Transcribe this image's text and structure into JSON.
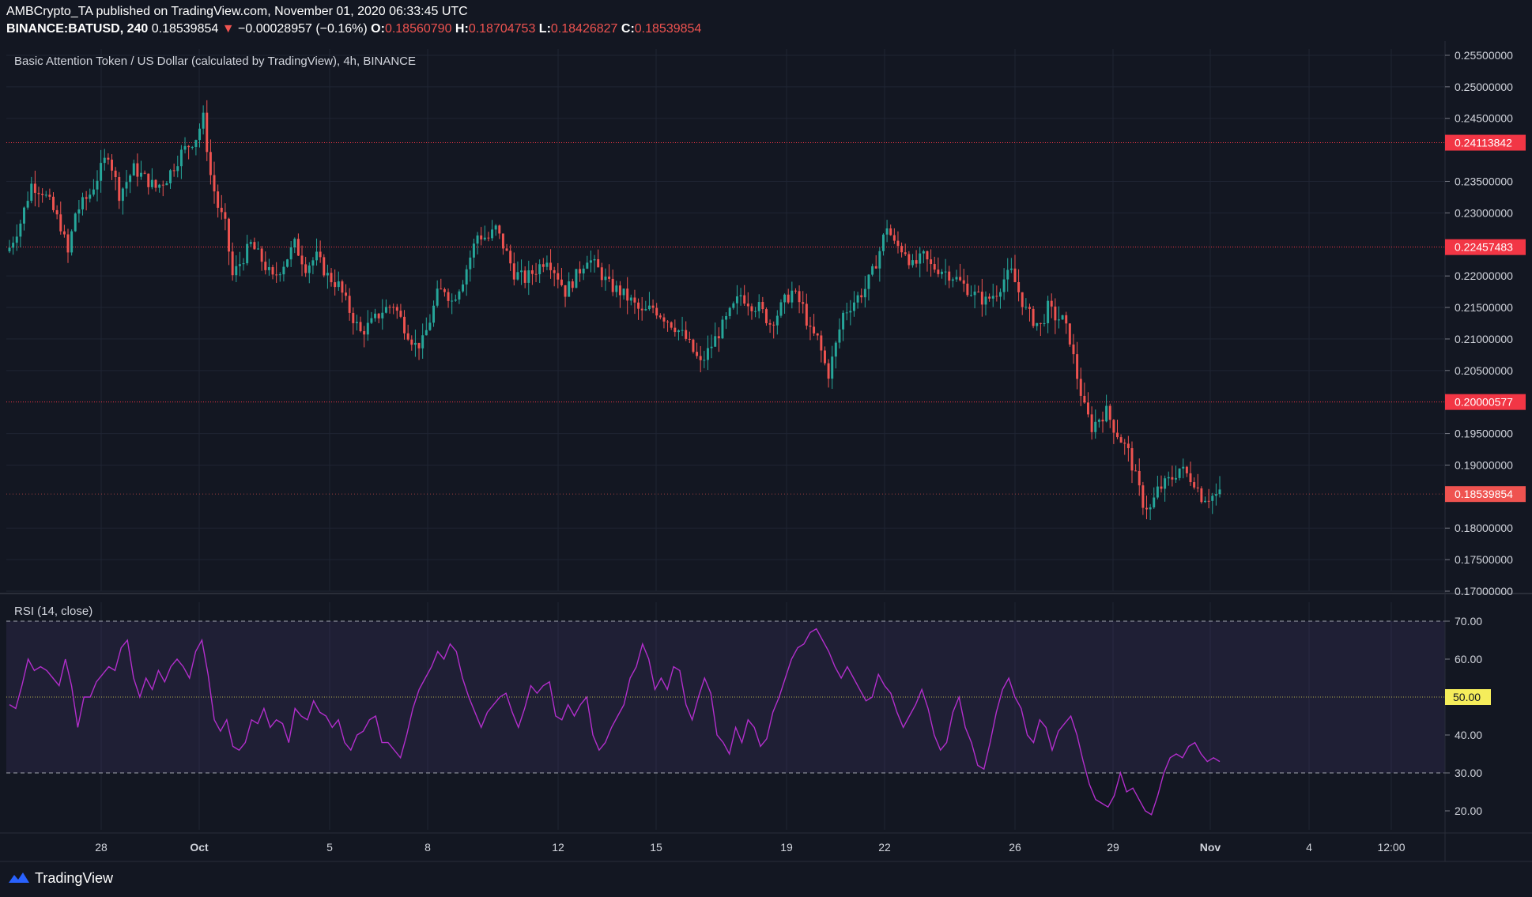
{
  "header": {
    "line1": "AMBCrypto_TA published on TradingView.com, November 01, 2020 06:33:45 UTC",
    "symbol": "BINANCE:BATUSD, 240",
    "last": "0.18539854",
    "change_arrow": "▼",
    "change": "−0.00028957 (−0.16%)",
    "o_label": "O:",
    "o_value": "0.18560790",
    "h_label": "H:",
    "h_value": "0.18704753",
    "l_label": "L:",
    "l_value": "0.18426827",
    "c_label": "C:",
    "c_value": "0.18539854"
  },
  "footer": {
    "brand": "TradingView"
  },
  "colors": {
    "background": "#131722",
    "up": "#26a69a",
    "down": "#ef5350",
    "rsi_line": "#b22ecb",
    "rsi_band": "#7e57c2",
    "midline": "#f5ed5b",
    "level_line": "#f23645"
  },
  "chart_data": [
    {
      "type": "candlestick",
      "title": "Basic Attention Token / US Dollar (calculated by TradingView), 4h, BINANCE",
      "ylim": [
        0.17,
        0.256
      ],
      "y_ticks": [
        "0.25500000",
        "0.25000000",
        "0.24500000",
        "0.23500000",
        "0.23000000",
        "0.22000000",
        "0.21500000",
        "0.21000000",
        "0.20500000",
        "0.19500000",
        "0.19000000",
        "0.18000000",
        "0.17500000",
        "0.17000000"
      ],
      "x_ticks": [
        "28",
        "Oct",
        "5",
        "8",
        "12",
        "15",
        "19",
        "22",
        "26",
        "29",
        "Nov",
        "4",
        "12:00"
      ],
      "horizontal_levels": [
        "0.24113842",
        "0.22457483",
        "0.20000577"
      ],
      "last_price_label": "0.18539854",
      "close_path": [
        [
          0,
          0.2245
        ],
        [
          3,
          0.2285
        ],
        [
          6,
          0.2345
        ],
        [
          9,
          0.2335
        ],
        [
          11,
          0.2315
        ],
        [
          14,
          0.228
        ],
        [
          16,
          0.2235
        ],
        [
          18,
          0.23
        ],
        [
          22,
          0.233
        ],
        [
          27,
          0.2395
        ],
        [
          30,
          0.233
        ],
        [
          34,
          0.237
        ],
        [
          36,
          0.236
        ],
        [
          40,
          0.234
        ],
        [
          43,
          0.2355
        ],
        [
          47,
          0.2395
        ],
        [
          51,
          0.242
        ],
        [
          53,
          0.245
        ],
        [
          55,
          0.236
        ],
        [
          57,
          0.231
        ],
        [
          59,
          0.228
        ],
        [
          61,
          0.22
        ],
        [
          63,
          0.222
        ],
        [
          66,
          0.225
        ],
        [
          69,
          0.2225
        ],
        [
          72,
          0.2195
        ],
        [
          75,
          0.222
        ],
        [
          78,
          0.225
        ],
        [
          81,
          0.2215
        ],
        [
          84,
          0.223
        ],
        [
          87,
          0.22
        ],
        [
          90,
          0.2185
        ],
        [
          93,
          0.2145
        ],
        [
          96,
          0.211
        ],
        [
          99,
          0.2125
        ],
        [
          102,
          0.2145
        ],
        [
          105,
          0.2155
        ],
        [
          108,
          0.212
        ],
        [
          111,
          0.209
        ],
        [
          113,
          0.2095
        ],
        [
          115,
          0.213
        ],
        [
          117,
          0.217
        ],
        [
          119,
          0.218
        ],
        [
          121,
          0.216
        ],
        [
          124,
          0.2195
        ],
        [
          126,
          0.223
        ],
        [
          128,
          0.2265
        ],
        [
          131,
          0.226
        ],
        [
          133,
          0.2275
        ],
        [
          136,
          0.2235
        ],
        [
          138,
          0.2205
        ],
        [
          141,
          0.2195
        ],
        [
          144,
          0.221
        ],
        [
          147,
          0.223
        ],
        [
          150,
          0.22
        ],
        [
          152,
          0.2175
        ],
        [
          155,
          0.22
        ],
        [
          158,
          0.223
        ],
        [
          161,
          0.221
        ],
        [
          164,
          0.2185
        ],
        [
          167,
          0.2175
        ],
        [
          170,
          0.216
        ],
        [
          173,
          0.214
        ],
        [
          176,
          0.215
        ],
        [
          179,
          0.2135
        ],
        [
          182,
          0.212
        ],
        [
          185,
          0.21
        ],
        [
          187,
          0.208
        ],
        [
          189,
          0.206
        ],
        [
          191,
          0.208
        ],
        [
          193,
          0.21
        ],
        [
          196,
          0.213
        ],
        [
          198,
          0.215
        ],
        [
          200,
          0.217
        ],
        [
          203,
          0.2155
        ],
        [
          205,
          0.215
        ],
        [
          208,
          0.2125
        ],
        [
          210,
          0.214
        ],
        [
          212,
          0.216
        ],
        [
          214,
          0.2175
        ],
        [
          217,
          0.215
        ],
        [
          219,
          0.211
        ],
        [
          221,
          0.21
        ],
        [
          223,
          0.206
        ],
        [
          224,
          0.2045
        ],
        [
          226,
          0.209
        ],
        [
          228,
          0.214
        ],
        [
          231,
          0.216
        ],
        [
          234,
          0.218
        ],
        [
          236,
          0.2205
        ],
        [
          238,
          0.224
        ],
        [
          240,
          0.228
        ],
        [
          242,
          0.225
        ],
        [
          245,
          0.224
        ],
        [
          247,
          0.2215
        ],
        [
          250,
          0.223
        ],
        [
          252,
          0.2215
        ],
        [
          255,
          0.221
        ],
        [
          258,
          0.22
        ],
        [
          261,
          0.2185
        ],
        [
          264,
          0.217
        ],
        [
          267,
          0.216
        ],
        [
          270,
          0.2175
        ],
        [
          272,
          0.2195
        ],
        [
          274,
          0.2205
        ],
        [
          276,
          0.2175
        ],
        [
          278,
          0.2145
        ],
        [
          280,
          0.213
        ],
        [
          282,
          0.212
        ],
        [
          284,
          0.215
        ],
        [
          286,
          0.2135
        ],
        [
          288,
          0.213
        ],
        [
          290,
          0.21
        ],
        [
          291,
          0.207
        ],
        [
          292,
          0.204
        ],
        [
          294,
          0.199
        ],
        [
          296,
          0.196
        ],
        [
          298,
          0.1975
        ],
        [
          300,
          0.1985
        ],
        [
          302,
          0.196
        ],
        [
          304,
          0.194
        ],
        [
          306,
          0.192
        ],
        [
          308,
          0.188
        ],
        [
          310,
          0.184
        ],
        [
          312,
          0.183
        ],
        [
          314,
          0.186
        ],
        [
          316,
          0.187
        ],
        [
          318,
          0.188
        ],
        [
          320,
          0.1895
        ],
        [
          322,
          0.1885
        ],
        [
          324,
          0.1875
        ],
        [
          326,
          0.185
        ],
        [
          328,
          0.185
        ],
        [
          330,
          0.1852
        ],
        [
          331,
          0.1854
        ]
      ]
    },
    {
      "type": "line",
      "title": "RSI (14, close)",
      "ylim": [
        15,
        75
      ],
      "y_ticks": [
        "70.00",
        "60.00",
        "40.00",
        "30.00",
        "20.00"
      ],
      "levels": [
        70,
        50,
        30
      ],
      "midline_label": "50.00",
      "values": [
        48,
        47,
        53,
        60,
        57,
        58,
        57,
        55,
        53,
        60,
        53,
        42,
        50,
        50,
        54,
        56,
        58,
        57,
        63,
        65,
        55,
        50,
        55,
        52,
        57,
        54,
        58,
        60,
        58,
        55,
        62,
        65,
        56,
        44,
        41,
        44,
        37,
        36,
        38,
        44,
        43,
        47,
        42,
        44,
        43,
        38,
        47,
        45,
        44,
        49,
        46,
        45,
        42,
        44,
        38,
        36,
        40,
        41,
        44,
        45,
        38,
        38,
        36,
        34,
        40,
        47,
        52,
        55,
        58,
        62,
        60,
        64,
        62,
        55,
        50,
        46,
        42,
        46,
        48,
        50,
        51,
        46,
        42,
        47,
        53,
        51,
        53,
        54,
        45,
        44,
        48,
        45,
        48,
        50,
        40,
        36,
        38,
        42,
        45,
        48,
        55,
        58,
        64,
        60,
        52,
        55,
        52,
        58,
        57,
        48,
        44,
        50,
        55,
        51,
        40,
        38,
        35,
        42,
        38,
        44,
        42,
        37,
        39,
        46,
        50,
        55,
        60,
        63,
        64,
        67,
        68,
        65,
        62,
        58,
        55,
        58,
        55,
        52,
        49,
        50,
        56,
        53,
        51,
        46,
        42,
        45,
        48,
        52,
        47,
        40,
        36,
        38,
        46,
        50,
        42,
        38,
        32,
        31,
        38,
        46,
        52,
        55,
        50,
        47,
        40,
        38,
        44,
        42,
        36,
        41,
        43,
        45,
        40,
        33,
        27,
        23,
        22,
        21,
        24,
        30,
        25,
        26,
        23,
        20,
        19,
        24,
        30,
        34,
        35,
        34,
        37,
        38,
        35,
        33,
        34,
        33
      ]
    }
  ]
}
